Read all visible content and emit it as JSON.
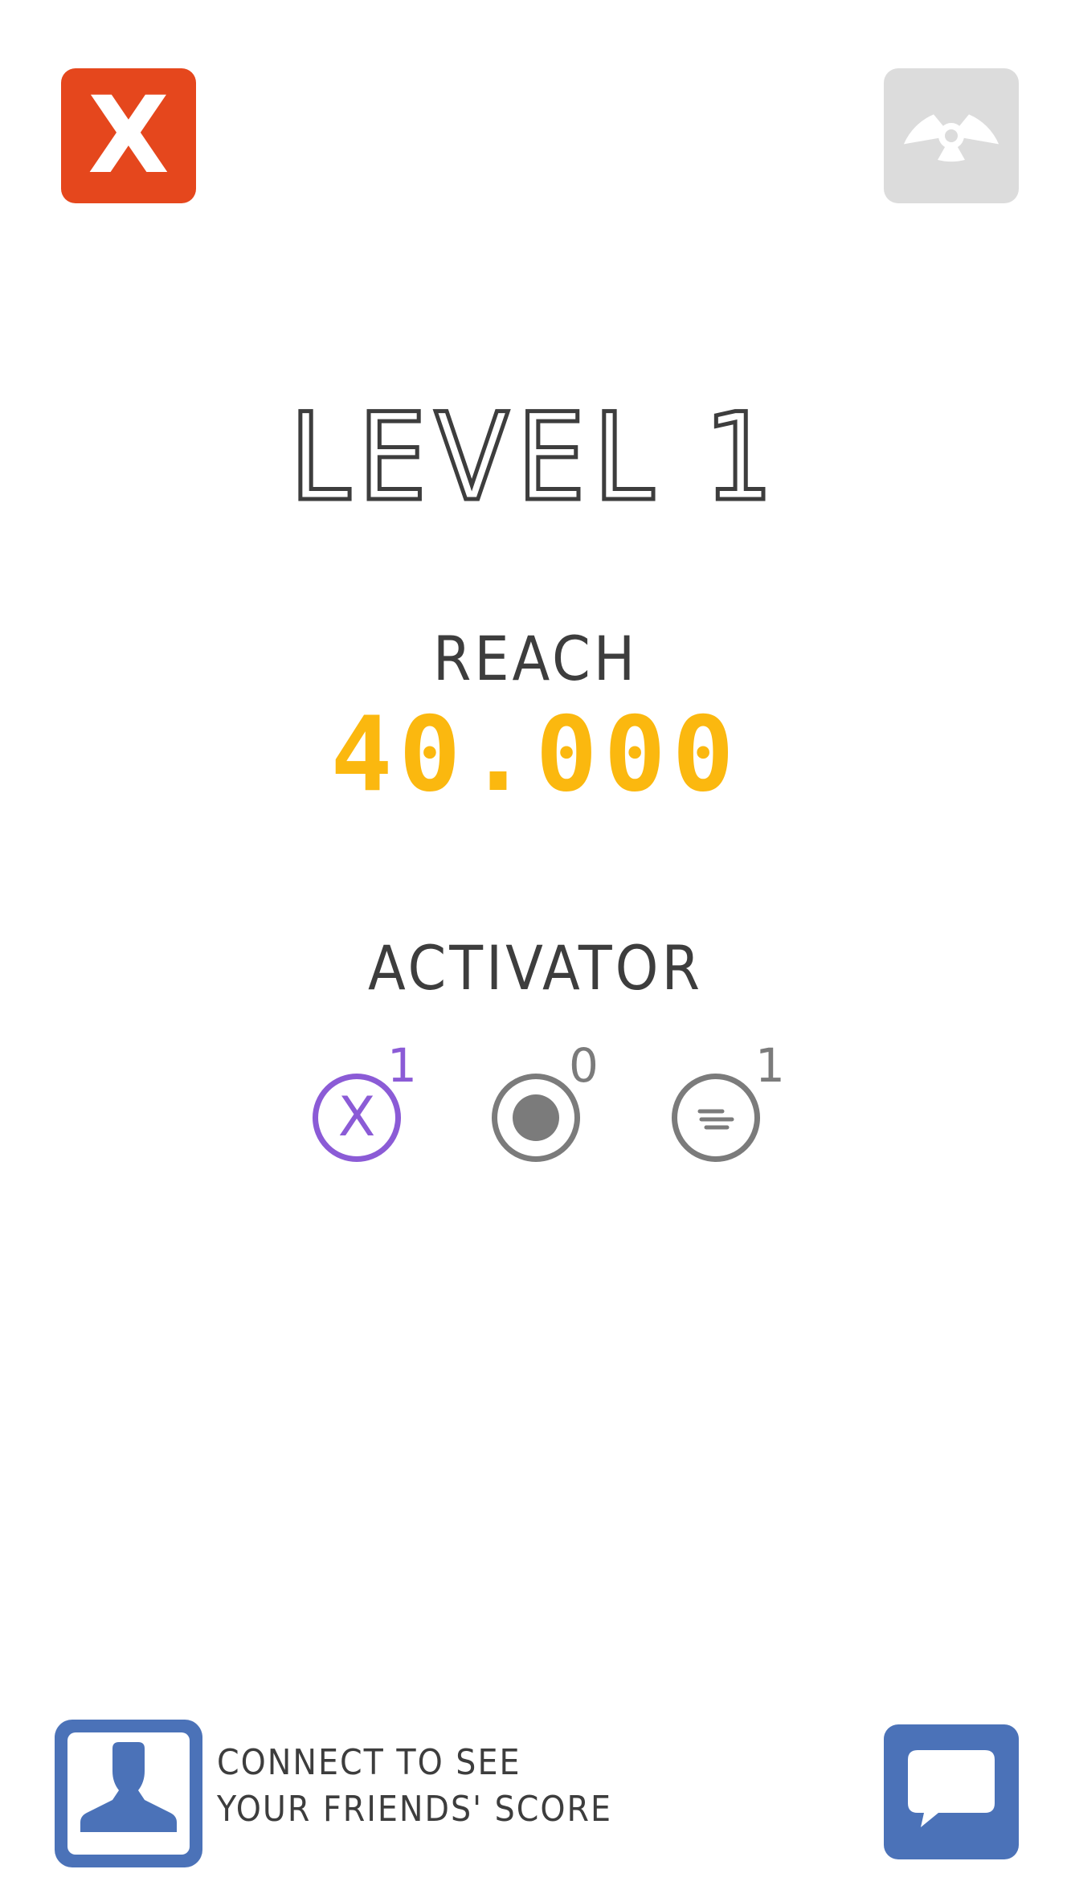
{
  "top_bar": {
    "close_label": "X",
    "close_icon": "close-icon",
    "radiation_icon": "radiation-icon"
  },
  "level": {
    "title": "LEVEL 1"
  },
  "goal": {
    "label": "REACH",
    "value": "40.000"
  },
  "activator": {
    "label": "ACTIVATOR",
    "items": [
      {
        "icon": "x-circle-icon",
        "glyph": "X",
        "count": "1",
        "color": "#8b5bd6"
      },
      {
        "icon": "dot-circle-icon",
        "count": "0",
        "color": "#7b7b7b"
      },
      {
        "icon": "lines-circle-icon",
        "count": "1",
        "color": "#7b7b7b"
      }
    ]
  },
  "social": {
    "connect_line1": "CONNECT TO SEE",
    "connect_line2": "YOUR FRIENDS' SCORE",
    "profile_icon": "profile-icon",
    "chat_icon": "chat-icon"
  },
  "colors": {
    "close": "#e5471d",
    "radiation": "#dcdcdc",
    "goal": "#fbb80f",
    "social": "#4b72b8",
    "text": "#3d3d3d"
  }
}
